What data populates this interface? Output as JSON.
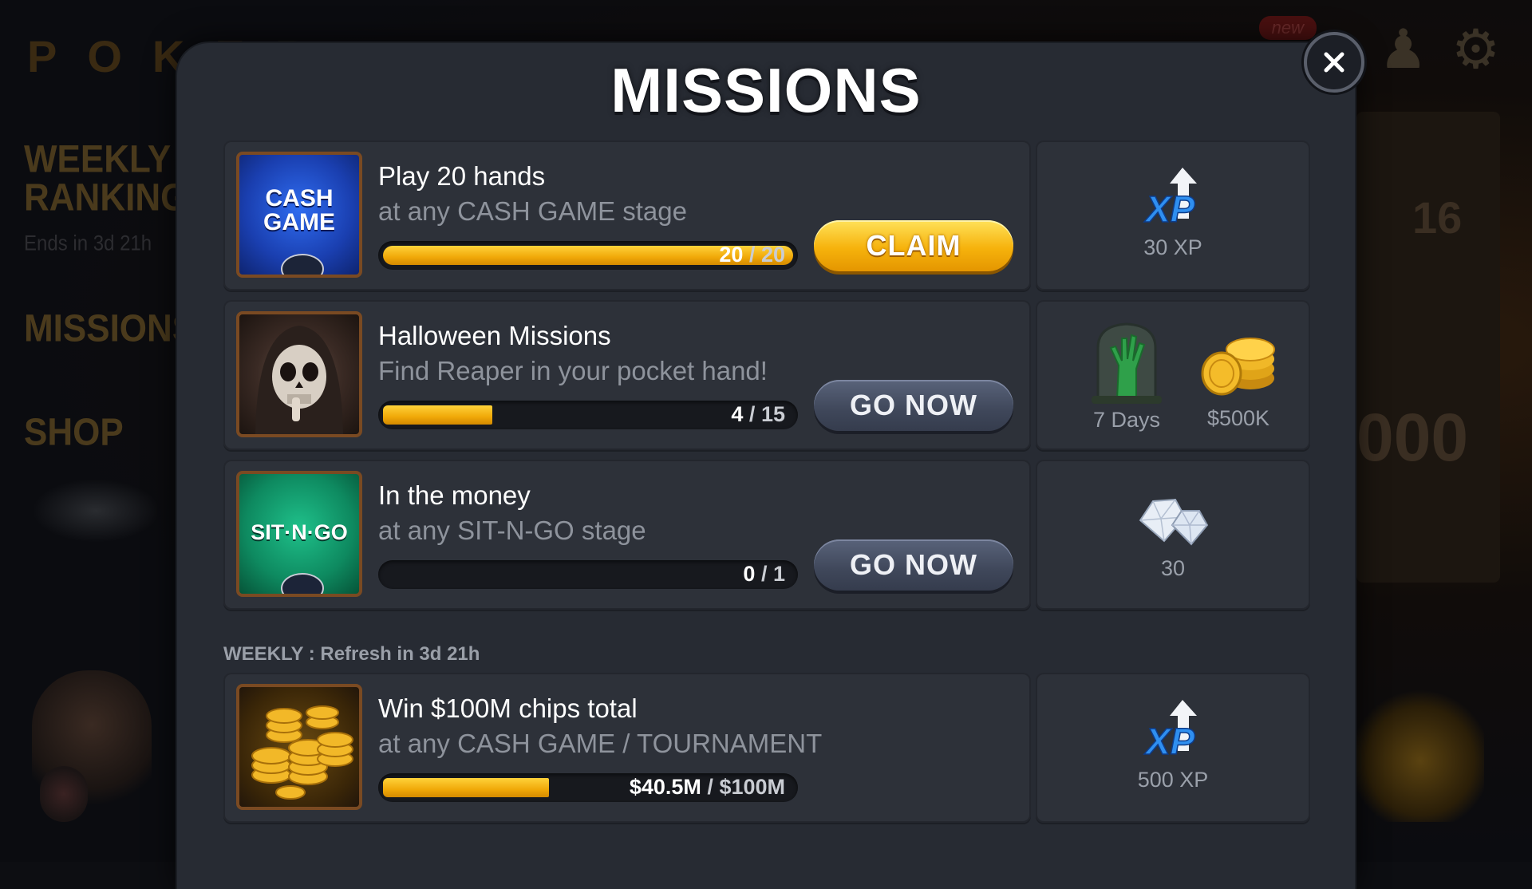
{
  "background": {
    "logo_text": "POKER",
    "side_menu": [
      {
        "label": "WEEKLY"
      },
      {
        "label": "RANKINGS"
      },
      {
        "label": "Ends in 3d 21h"
      },
      {
        "label": "MISSIONS"
      },
      {
        "label": "SHOP"
      }
    ],
    "new_badge": "new",
    "right_number": "16",
    "right_big": "000"
  },
  "modal": {
    "title": "MISSIONS",
    "close_icon": "close-icon"
  },
  "daily_missions": [
    {
      "icon": "cash-game-icon",
      "thumb_text": "CASH GAME",
      "title": "Play 20 hands",
      "subtitle": "at any CASH GAME stage",
      "progress": 1.0,
      "progress_current": "20",
      "progress_sep": "/",
      "progress_total": "20",
      "button": "CLAIM",
      "rewards": [
        {
          "icon": "xp-icon",
          "label": "30 XP"
        }
      ]
    },
    {
      "icon": "reaper-icon",
      "title": "Halloween Missions",
      "subtitle": "Find Reaper in your pocket hand!",
      "progress": 0.2667,
      "progress_current": "4",
      "progress_sep": "/",
      "progress_total": "15",
      "button": "GO NOW",
      "rewards": [
        {
          "icon": "zombie-hand-icon",
          "label": "7 Days"
        },
        {
          "icon": "chips-icon",
          "label": "$500K"
        }
      ]
    },
    {
      "icon": "sit-n-go-icon",
      "thumb_text": "SIT·N·GO",
      "title": "In the money",
      "subtitle": "at any SIT-N-GO stage",
      "progress": 0,
      "progress_current": "0",
      "progress_sep": "/",
      "progress_total": "1",
      "button": "GO NOW",
      "rewards": [
        {
          "icon": "diamonds-icon",
          "label": "30"
        }
      ]
    }
  ],
  "weekly": {
    "section_label": "WEEKLY : Refresh in 3d 21h",
    "missions": [
      {
        "icon": "gold-coins-icon",
        "title": "Win $100M chips total",
        "subtitle": "at any CASH GAME / TOURNAMENT",
        "progress": 0.405,
        "progress_current": "$40.5M",
        "progress_sep": "/",
        "progress_total": "$100M",
        "rewards": [
          {
            "icon": "xp-icon",
            "label": "500 XP"
          }
        ]
      }
    ]
  },
  "colors": {
    "progress_fill": "#f0a808",
    "claim_button": "#f6b20c",
    "go_button": "#3f475a",
    "xp_blue": "#2f8ff0"
  }
}
